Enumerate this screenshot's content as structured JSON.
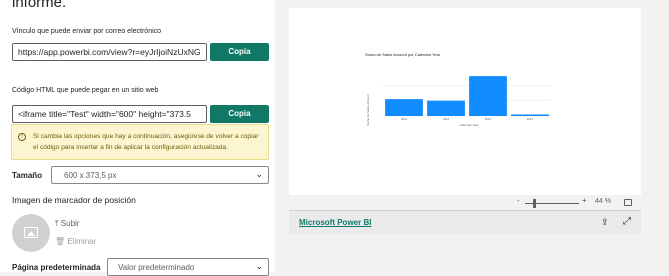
{
  "intro": {
    "text": "informe."
  },
  "link": {
    "label": "Vínculo que puede enviar por correo electrónico",
    "value": "https://app.powerbi.com/view?r=eyJrIjoiNzUxNG",
    "copy_label": "Copia"
  },
  "embed": {
    "label": "Código HTML que puede pegar en un sitio web",
    "value": "<iframe title=\"Test\" width=\"600\" height=\"373.5",
    "copy_label": "Copia"
  },
  "notice": {
    "icon": "info-icon",
    "text": "Si cambia las opciones que hay a continuación, asegúrese de volver a copiar el código para insertar a fin de aplicar la configuración actualizada.",
    "background": "#fbf5d0"
  },
  "size": {
    "label": "Tamaño",
    "value": "600 x 373,5 px"
  },
  "placeholder": {
    "heading": "Imagen de marcador de posición",
    "upload_label": "Subir",
    "delete_label": "Eliminar"
  },
  "default_page": {
    "label": "Página predeterminada",
    "value": "Valor predeterminado"
  },
  "chart_data": {
    "type": "bar",
    "title": "Suma de Sales Amount por Calendar Year",
    "xlabel": "Calendar Year",
    "ylabel": "Suma de Sales Amount",
    "categories": [
      "2011",
      "2012",
      "2013",
      "2014"
    ],
    "values": [
      11,
      10,
      26,
      1
    ],
    "ylim": [
      0,
      30
    ],
    "bar_color": "#118dff"
  },
  "zoom": {
    "minus": "-",
    "plus": "+",
    "percent": "44 %"
  },
  "footer": {
    "brand": "Microsoft Power BI"
  },
  "colors": {
    "accent": "#117865"
  }
}
